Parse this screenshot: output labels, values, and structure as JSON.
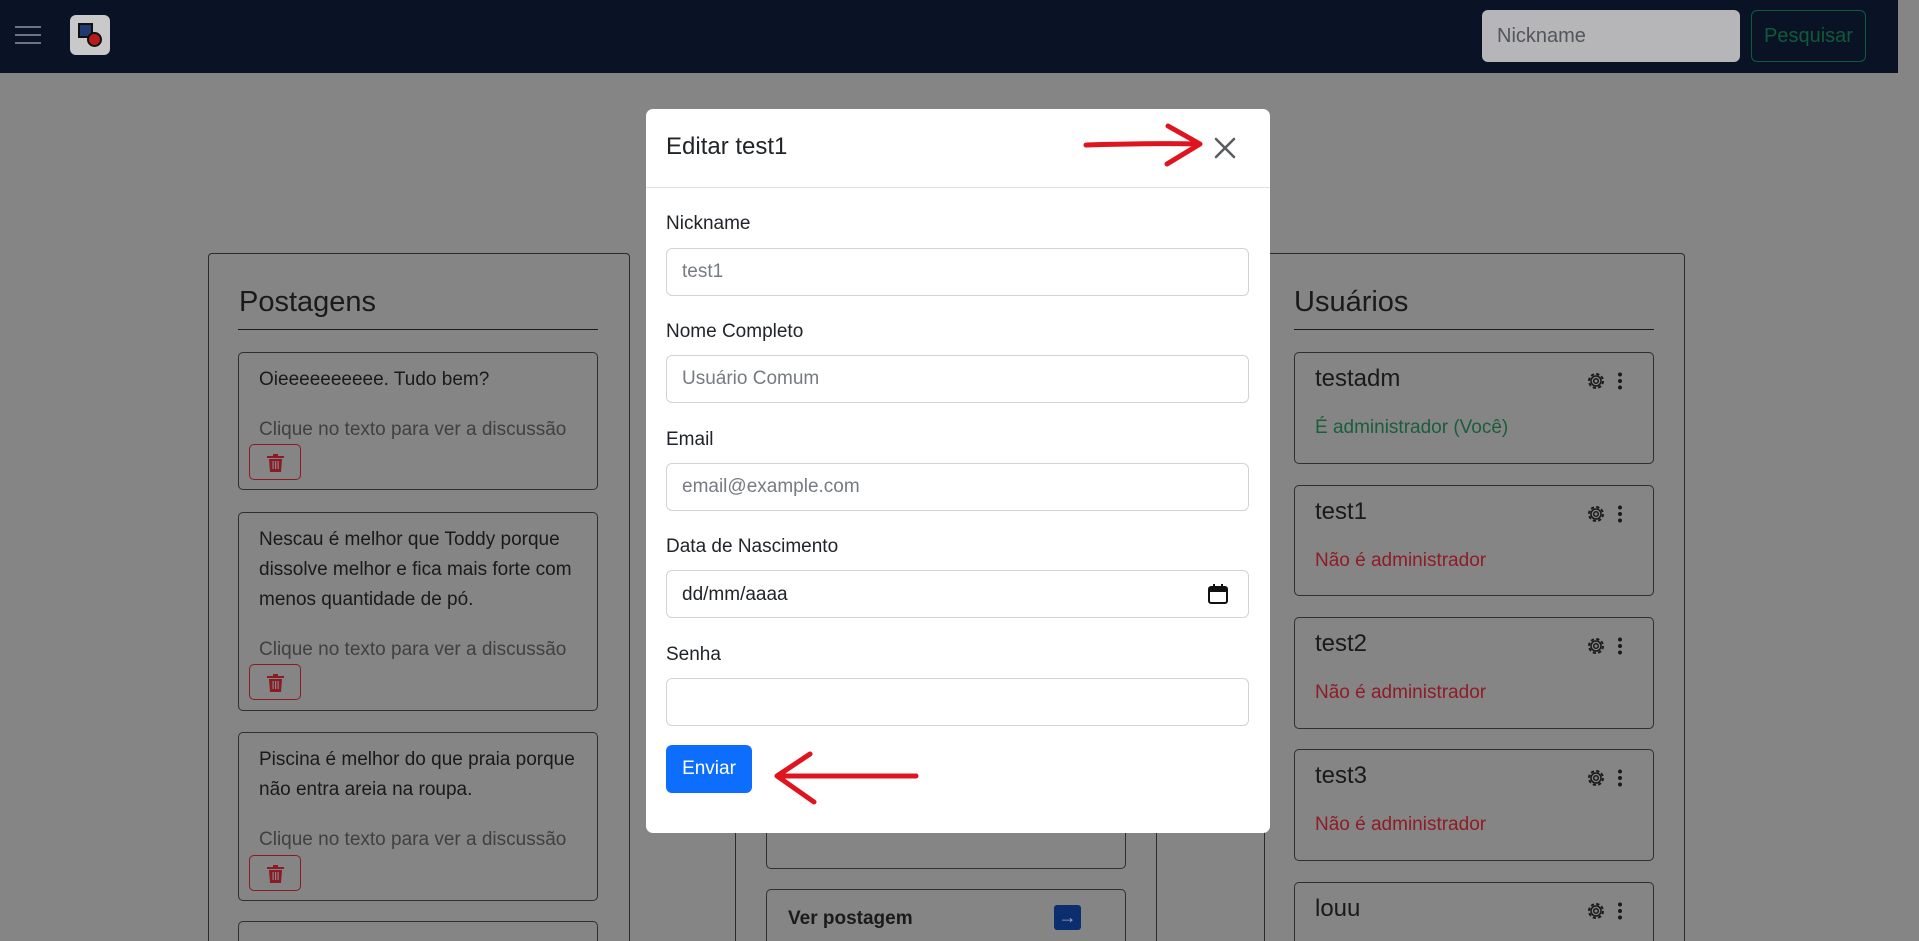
{
  "navbar": {
    "search_placeholder": "Nickname",
    "search_button": "Pesquisar"
  },
  "posts": {
    "title": "Postagens",
    "items": [
      {
        "text": "Oieeeeeeeeee. Tudo bem?",
        "hint": "Clique no texto para ver a discussão"
      },
      {
        "text": "Nescau é melhor que Toddy porque dissolve melhor e fica mais forte com menos quantidade de pó.",
        "hint": "Clique no texto para ver a discussão"
      },
      {
        "text": "Piscina é melhor do que praia porque não entra areia na roupa.",
        "hint": "Clique no texto para ver a discussão"
      }
    ]
  },
  "middle": {
    "view_post": "Ver postagem"
  },
  "users": {
    "title": "Usuários",
    "items": [
      {
        "name": "testadm",
        "role": "É administrador (Você)"
      },
      {
        "name": "test1",
        "role": "Não é administrador"
      },
      {
        "name": "test2",
        "role": "Não é administrador"
      },
      {
        "name": "test3",
        "role": "Não é administrador"
      },
      {
        "name": "louu",
        "role": ""
      }
    ]
  },
  "modal": {
    "title": "Editar test1",
    "nickname_label": "Nickname",
    "nickname_placeholder": "test1",
    "fullname_label": "Nome Completo",
    "fullname_placeholder": "Usuário Comum",
    "email_label": "Email",
    "email_placeholder": "email@example.com",
    "birthdate_label": "Data de Nascimento",
    "birthdate_value": "dd/mm/aaaa",
    "password_label": "Senha",
    "password_value": "",
    "submit_label": "Enviar"
  },
  "colors": {
    "admin_role": "#1a5e3a",
    "non_admin_role": "#8e1c26",
    "primary": "#0d6efd",
    "annotation_arrow": "#e0141e"
  },
  "icons": {
    "menu": "hamburger-icon",
    "close": "close-icon",
    "trash": "trash-icon",
    "gear": "gear-icon",
    "more": "kebab-menu-icon",
    "calendar": "calendar-icon",
    "arrow": "arrow-right-icon"
  }
}
